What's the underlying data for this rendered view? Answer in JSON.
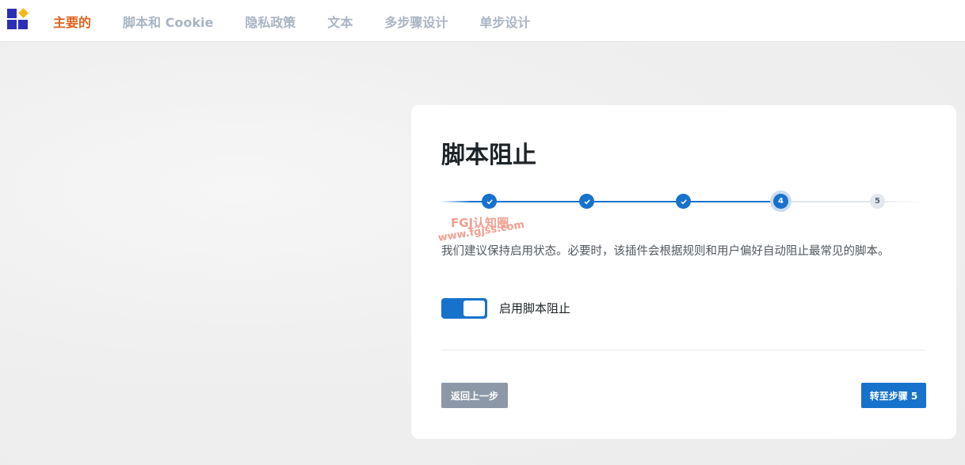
{
  "nav": {
    "items": [
      {
        "label": "主要的",
        "active": true
      },
      {
        "label": "脚本和 Cookie",
        "active": false
      },
      {
        "label": "隐私政策",
        "active": false
      },
      {
        "label": "文本",
        "active": false
      },
      {
        "label": "多步骤设计",
        "active": false
      },
      {
        "label": "单步设计",
        "active": false
      }
    ]
  },
  "card": {
    "title": "脚本阻止",
    "steps": [
      {
        "label": "✓",
        "state": "done"
      },
      {
        "label": "✓",
        "state": "done"
      },
      {
        "label": "✓",
        "state": "done"
      },
      {
        "label": "4",
        "state": "current"
      },
      {
        "label": "5",
        "state": "todo"
      }
    ],
    "description": "我们建议保持启用状态。必要时，该插件会根据规则和用户偏好自动阻止最常见的脚本。",
    "toggle": {
      "label": "启用脚本阻止",
      "enabled": true
    },
    "back_button": "返回上一步",
    "next_button": "转至步骤 5"
  },
  "watermark": {
    "line1": "FGJ认知圈",
    "line2": "www.fgjss.com"
  },
  "colors": {
    "accent": "#1772cb",
    "nav_active": "#e0621c",
    "nav_inactive": "#a9b4c4",
    "back_button": "#8c98a7"
  }
}
